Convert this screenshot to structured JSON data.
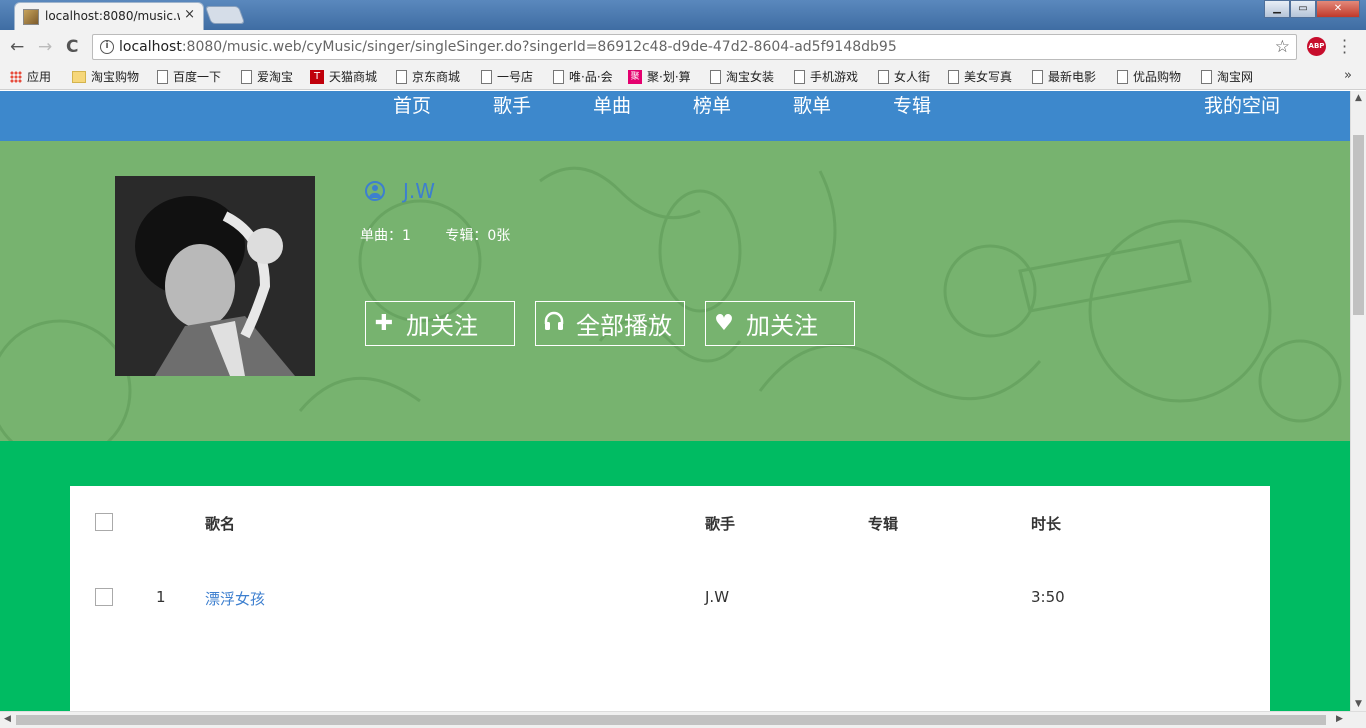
{
  "browser": {
    "tab_title": "localhost:8080/music.w",
    "tab_close": "×",
    "url_host": "localhost",
    "url_rest": ":8080/music.web/cyMusic/singer/singleSinger.do?singerId=86912c48-d9de-47d2-8604-ad5f9148db95",
    "back": "←",
    "forward": "→",
    "reload": "C",
    "star": "☆",
    "abp": "ABP",
    "window_buttons": [
      "▁",
      "▭",
      "✕"
    ],
    "bookmarks": [
      {
        "label": "应用",
        "icon": "apps"
      },
      {
        "label": "淘宝购物",
        "icon": "folder"
      },
      {
        "label": "百度一下",
        "icon": "page"
      },
      {
        "label": "爱淘宝",
        "icon": "page"
      },
      {
        "label": "天猫商城",
        "icon": "tmall",
        "glyph": "T"
      },
      {
        "label": "京东商城",
        "icon": "page"
      },
      {
        "label": "一号店",
        "icon": "page"
      },
      {
        "label": "唯·品·会",
        "icon": "page"
      },
      {
        "label": "聚·划·算",
        "icon": "juhuasuan",
        "glyph": "聚"
      },
      {
        "label": "淘宝女装",
        "icon": "page"
      },
      {
        "label": "手机游戏",
        "icon": "page"
      },
      {
        "label": "女人街",
        "icon": "page"
      },
      {
        "label": "美女写真",
        "icon": "page"
      },
      {
        "label": "最新电影",
        "icon": "page"
      },
      {
        "label": "优品购物",
        "icon": "page"
      },
      {
        "label": "淘宝网",
        "icon": "page"
      }
    ],
    "bookmarks_more": "»"
  },
  "nav": {
    "items": [
      "首页",
      "歌手",
      "单曲",
      "榜单",
      "歌单",
      "专辑"
    ],
    "my_space": "我的空间"
  },
  "singer": {
    "name": "J.W",
    "single_count": "单曲：1",
    "album_count": "专辑：0张",
    "buttons": [
      {
        "label": "加关注",
        "icon": "plus-icon",
        "glyph": "✚"
      },
      {
        "label": "全部播放",
        "icon": "headphones-icon",
        "glyph": "🎧"
      },
      {
        "label": "加关注",
        "icon": "heart-icon",
        "glyph": "♥"
      }
    ]
  },
  "table": {
    "headers": {
      "name": "歌名",
      "singer": "歌手",
      "album": "专辑",
      "duration": "时长"
    },
    "rows": [
      {
        "index": "1",
        "name": "漂浮女孩",
        "singer": "J.W",
        "album": "",
        "duration": "3:50"
      }
    ]
  },
  "colors": {
    "nav_bg": "#3d88cc",
    "hero_bg": "#77b36f",
    "page_bg": "#00bb62",
    "accent": "#3d7fcf"
  }
}
